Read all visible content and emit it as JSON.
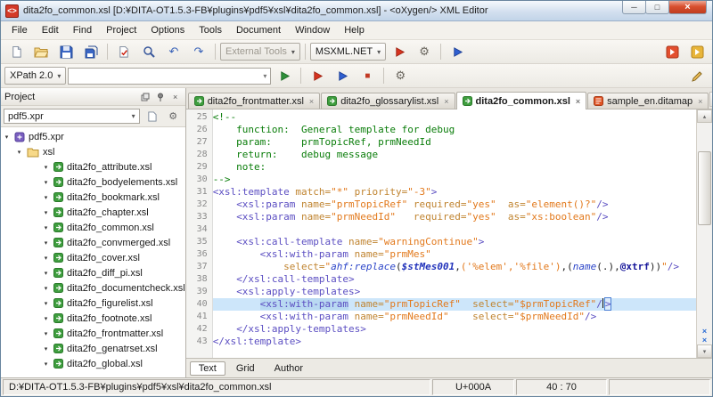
{
  "window": {
    "title": "dita2fo_common.xsl [D:¥DITA-OT1.5.3-FB¥plugins¥pdf5¥xsl¥dita2fo_common.xsl] - <oXygen/> XML Editor"
  },
  "menu": [
    "File",
    "Edit",
    "Find",
    "Project",
    "Options",
    "Tools",
    "Document",
    "Window",
    "Help"
  ],
  "toolbar": {
    "external_tools": "External Tools",
    "engine": "MSXML.NET",
    "xpath": "XPath 2.0",
    "xpath_input_value": ""
  },
  "icons": {
    "app_glyph": "<>",
    "dropdown": "▾",
    "minimize": "─",
    "maximize": "□",
    "close": "×",
    "tab_close": "×",
    "undo": "↶",
    "redo": "↷",
    "gear": "⚙",
    "scroll_up": "▴",
    "scroll_down": "▾",
    "tab_prev": "◂",
    "tab_next": "▸",
    "split_mark": "×",
    "expander": "▾",
    "stop": "■"
  },
  "project": {
    "title": "Project",
    "combo": "pdf5.xpr",
    "root": "pdf5.xpr",
    "folder": "xsl",
    "files": [
      "dita2fo_attribute.xsl",
      "dita2fo_bodyelements.xsl",
      "dita2fo_bookmark.xsl",
      "dita2fo_chapter.xsl",
      "dita2fo_common.xsl",
      "dita2fo_convmerged.xsl",
      "dita2fo_cover.xsl",
      "dita2fo_diff_pi.xsl",
      "dita2fo_documentcheck.xsl",
      "dita2fo_figurelist.xsl",
      "dita2fo_footnote.xsl",
      "dita2fo_frontmatter.xsl",
      "dita2fo_genatrset.xsl",
      "dita2fo_global.xsl"
    ]
  },
  "tabs": [
    {
      "label": "dita2fo_frontmatter.xsl",
      "type": "xsl",
      "active": false
    },
    {
      "label": "dita2fo_glossarylist.xsl",
      "type": "xsl",
      "active": false
    },
    {
      "label": "dita2fo_common.xsl",
      "type": "xsl",
      "active": true
    },
    {
      "label": "sample_en.ditamap",
      "type": "ditamap",
      "active": false
    }
  ],
  "editor": {
    "current_line": 40,
    "lines": [
      {
        "no": 25,
        "t": [
          [
            "cm",
            "<!--"
          ]
        ]
      },
      {
        "no": 26,
        "t": [
          [
            "cm",
            "    function:  General template for debug"
          ]
        ]
      },
      {
        "no": 27,
        "t": [
          [
            "cm",
            "    param:     prmTopicRef, prmNeedId"
          ]
        ]
      },
      {
        "no": 28,
        "t": [
          [
            "cm",
            "    return:    debug message"
          ]
        ]
      },
      {
        "no": 29,
        "t": [
          [
            "cm",
            "    note:"
          ]
        ]
      },
      {
        "no": 30,
        "t": [
          [
            "cm",
            "-->"
          ]
        ]
      },
      {
        "no": 31,
        "t": [
          [
            "tag",
            "<xsl:template "
          ],
          [
            "attr",
            "match="
          ],
          [
            "val",
            "\"*\""
          ],
          [
            "pl",
            " "
          ],
          [
            "attr",
            "priority="
          ],
          [
            "val",
            "\"-3\""
          ],
          [
            "tag",
            ">"
          ]
        ]
      },
      {
        "no": 32,
        "t": [
          [
            "pl",
            "    "
          ],
          [
            "tag",
            "<xsl:param "
          ],
          [
            "attr",
            "name="
          ],
          [
            "val",
            "\"prmTopicRef\""
          ],
          [
            "pl",
            " "
          ],
          [
            "attr",
            "required="
          ],
          [
            "val",
            "\"yes\""
          ],
          [
            "pl",
            "  "
          ],
          [
            "attr",
            "as="
          ],
          [
            "val",
            "\"element()?\""
          ],
          [
            "tag",
            "/>"
          ]
        ]
      },
      {
        "no": 33,
        "t": [
          [
            "pl",
            "    "
          ],
          [
            "tag",
            "<xsl:param "
          ],
          [
            "attr",
            "name="
          ],
          [
            "val",
            "\"prmNeedId\""
          ],
          [
            "pl",
            "   "
          ],
          [
            "attr",
            "required="
          ],
          [
            "val",
            "\"yes\""
          ],
          [
            "pl",
            "  "
          ],
          [
            "attr",
            "as="
          ],
          [
            "val",
            "\"xs:boolean\""
          ],
          [
            "tag",
            "/>"
          ]
        ]
      },
      {
        "no": 34,
        "t": []
      },
      {
        "no": 35,
        "t": [
          [
            "pl",
            "    "
          ],
          [
            "tag",
            "<xsl:call-template "
          ],
          [
            "attr",
            "name="
          ],
          [
            "val",
            "\"warningContinue\""
          ],
          [
            "tag",
            ">"
          ]
        ]
      },
      {
        "no": 36,
        "t": [
          [
            "pl",
            "        "
          ],
          [
            "tag",
            "<xsl:with-param "
          ],
          [
            "attr",
            "name="
          ],
          [
            "val",
            "\"prmMes\""
          ]
        ]
      },
      {
        "no": 37,
        "t": [
          [
            "pl",
            "            "
          ],
          [
            "attr",
            "select="
          ],
          [
            "val",
            "\""
          ],
          [
            "fn",
            "ahf:replace"
          ],
          [
            "pl",
            "("
          ],
          [
            "var",
            "$stMes001"
          ],
          [
            "pl",
            ","
          ],
          [
            "str",
            "('%elem','%file')"
          ],
          [
            "pl",
            ",("
          ],
          [
            "fn",
            "name"
          ],
          [
            "pl",
            "(.),"
          ],
          [
            "at",
            "@xtrf"
          ],
          [
            "pl",
            "))"
          ],
          [
            "val",
            "\""
          ],
          [
            "tag",
            "/>"
          ]
        ]
      },
      {
        "no": 38,
        "t": [
          [
            "pl",
            "    "
          ],
          [
            "tag",
            "</xsl:call-template>"
          ]
        ]
      },
      {
        "no": 39,
        "t": [
          [
            "pl",
            "    "
          ],
          [
            "tag",
            "<xsl:apply-templates>"
          ]
        ]
      },
      {
        "no": 40,
        "t": [
          [
            "pl",
            "        "
          ],
          [
            "taghl",
            "<xsl:with-param"
          ],
          [
            "pl",
            " "
          ],
          [
            "attr",
            "name="
          ],
          [
            "val",
            "\"prmTopicRef\""
          ],
          [
            "pl",
            "  "
          ],
          [
            "attr",
            "select="
          ],
          [
            "val",
            "\"$prmTopicRef\""
          ],
          [
            "tag",
            "/"
          ],
          [
            "caret",
            ""
          ],
          [
            "box",
            ">"
          ]
        ]
      },
      {
        "no": 41,
        "t": [
          [
            "pl",
            "        "
          ],
          [
            "tag",
            "<xsl:with-param"
          ],
          [
            "pl",
            " "
          ],
          [
            "attr",
            "name="
          ],
          [
            "val",
            "\"prmNeedId\""
          ],
          [
            "pl",
            "    "
          ],
          [
            "attr",
            "select="
          ],
          [
            "val",
            "\"$prmNeedId\""
          ],
          [
            "tag",
            "/>"
          ]
        ]
      },
      {
        "no": 42,
        "t": [
          [
            "pl",
            "    "
          ],
          [
            "tag",
            "</xsl:apply-templates>"
          ]
        ]
      },
      {
        "no": 43,
        "t": [
          [
            "tag",
            "</xsl:template>"
          ]
        ]
      }
    ]
  },
  "mode_tabs": [
    {
      "label": "Text",
      "active": true
    },
    {
      "label": "Grid",
      "active": false
    },
    {
      "label": "Author",
      "active": false
    }
  ],
  "status": {
    "path": "D:¥DITA-OT1.5.3-FB¥plugins¥pdf5¥xsl¥dita2fo_common.xsl",
    "unicode": "U+000A",
    "position": "40 : 70"
  }
}
